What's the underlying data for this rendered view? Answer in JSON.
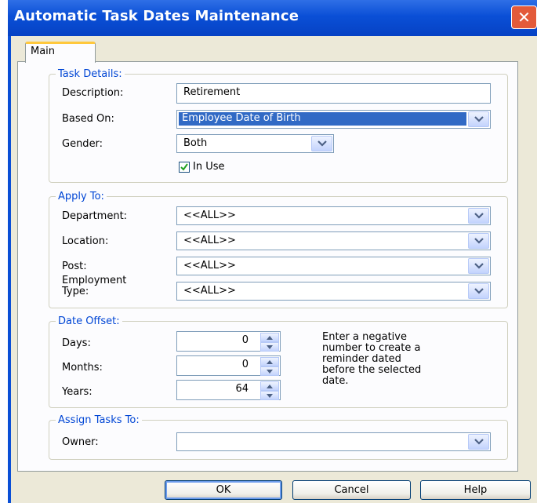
{
  "window": {
    "title": "Automatic Task Dates Maintenance",
    "close_glyph": "✕"
  },
  "tabs": [
    {
      "label": "Main",
      "selected": true
    }
  ],
  "task_details": {
    "legend": "Task Details:",
    "description_label": "Description:",
    "description_value": "Retirement",
    "based_on_label": "Based On:",
    "based_on_value": "Employee Date of Birth",
    "gender_label": "Gender:",
    "gender_value": "Both",
    "in_use_label": "In Use",
    "in_use_checked": true
  },
  "apply_to": {
    "legend": "Apply To:",
    "department_label": "Department:",
    "department_value": "<<ALL>>",
    "location_label": "Location:",
    "location_value": "<<ALL>>",
    "post_label": "Post:",
    "post_value": "<<ALL>>",
    "employment_type_label_1": "Employment",
    "employment_type_label_2": "Type:",
    "employment_type_value": "<<ALL>>"
  },
  "date_offset": {
    "legend": "Date Offset:",
    "days_label": "Days:",
    "days_value": "0",
    "months_label": "Months:",
    "months_value": "0",
    "years_label": "Years:",
    "years_value": "64",
    "note_lines": [
      "Enter a negative",
      "number to create a",
      "reminder dated",
      "before the selected",
      "date."
    ]
  },
  "assign_tasks": {
    "legend": "Assign Tasks To:",
    "owner_label": "Owner:",
    "owner_value": ""
  },
  "buttons": {
    "ok": "OK",
    "cancel": "Cancel",
    "help": "Help"
  },
  "colors": {
    "title_bar": "#0a4fd6",
    "legend_text": "#0046d5",
    "selection": "#316ac5",
    "dialog_bg": "#ece9d8",
    "close_button": "#e35a3a"
  },
  "icons": {
    "dropdown": "chevron-down-icon",
    "spin": "spin-arrows-icon",
    "check": "check-icon",
    "close": "close-icon"
  }
}
